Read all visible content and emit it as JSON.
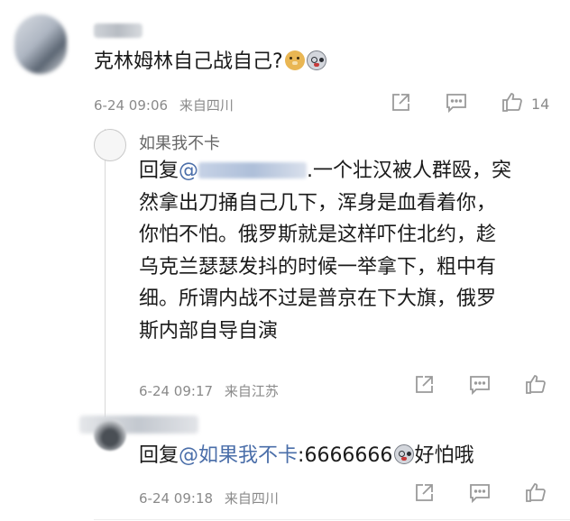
{
  "comment": {
    "text": "克林姆林自己战自己?",
    "emojis": [
      "doge-icon",
      "scared-face-icon"
    ],
    "time": "6-24 09:06",
    "location": "来自四川",
    "like_count": "14"
  },
  "replies": [
    {
      "username": "如果我不卡",
      "reply_prefix": "回复",
      "mention_at": "@",
      "lines": [
        ".一个壮汉被人群殴，突",
        "然拿出刀捅自己几下，浑身是血看着你，",
        "你怕不怕。俄罗斯就是这样吓住北约，趁",
        "乌克兰瑟瑟发抖的时候一举拿下，粗中有",
        "细。所谓内战不过是普京在下大旗，俄罗",
        "斯内部自导自演"
      ],
      "time": "6-24 09:17",
      "location": "来自江苏"
    },
    {
      "reply_prefix": "回复",
      "mention": "@如果我不卡",
      "text_before_emoji": ":6666666",
      "emoji": "scared-face-icon",
      "text_after_emoji": "好怕哦",
      "time": "6-24 09:18",
      "location": "来自四川"
    }
  ],
  "colors": {
    "mention": "#4a6ea9",
    "meta_text": "#8a8a8a",
    "icon": "#9a9a9a"
  }
}
